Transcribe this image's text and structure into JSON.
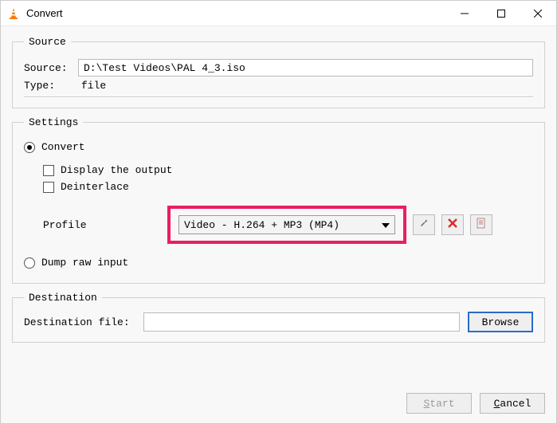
{
  "window": {
    "title": "Convert"
  },
  "source": {
    "legend": "Source",
    "label": "Source:",
    "value": "D:\\Test Videos\\PAL 4_3.iso",
    "type_label": "Type:",
    "type_value": "file"
  },
  "settings": {
    "legend": "Settings",
    "convert_label": "Convert",
    "display_output_label": "Display the output",
    "deinterlace_label": "Deinterlace",
    "profile_label": "Profile",
    "profile_value": "Video - H.264 + MP3 (MP4)",
    "dump_raw_label": "Dump raw input"
  },
  "destination": {
    "legend": "Destination",
    "label": "Destination file:",
    "value": "",
    "browse_label": "Browse"
  },
  "footer": {
    "start_full": "Start",
    "start_prefix": "S",
    "start_rest": "tart",
    "cancel_full": "Cancel",
    "cancel_prefix": "C",
    "cancel_rest": "ancel"
  }
}
